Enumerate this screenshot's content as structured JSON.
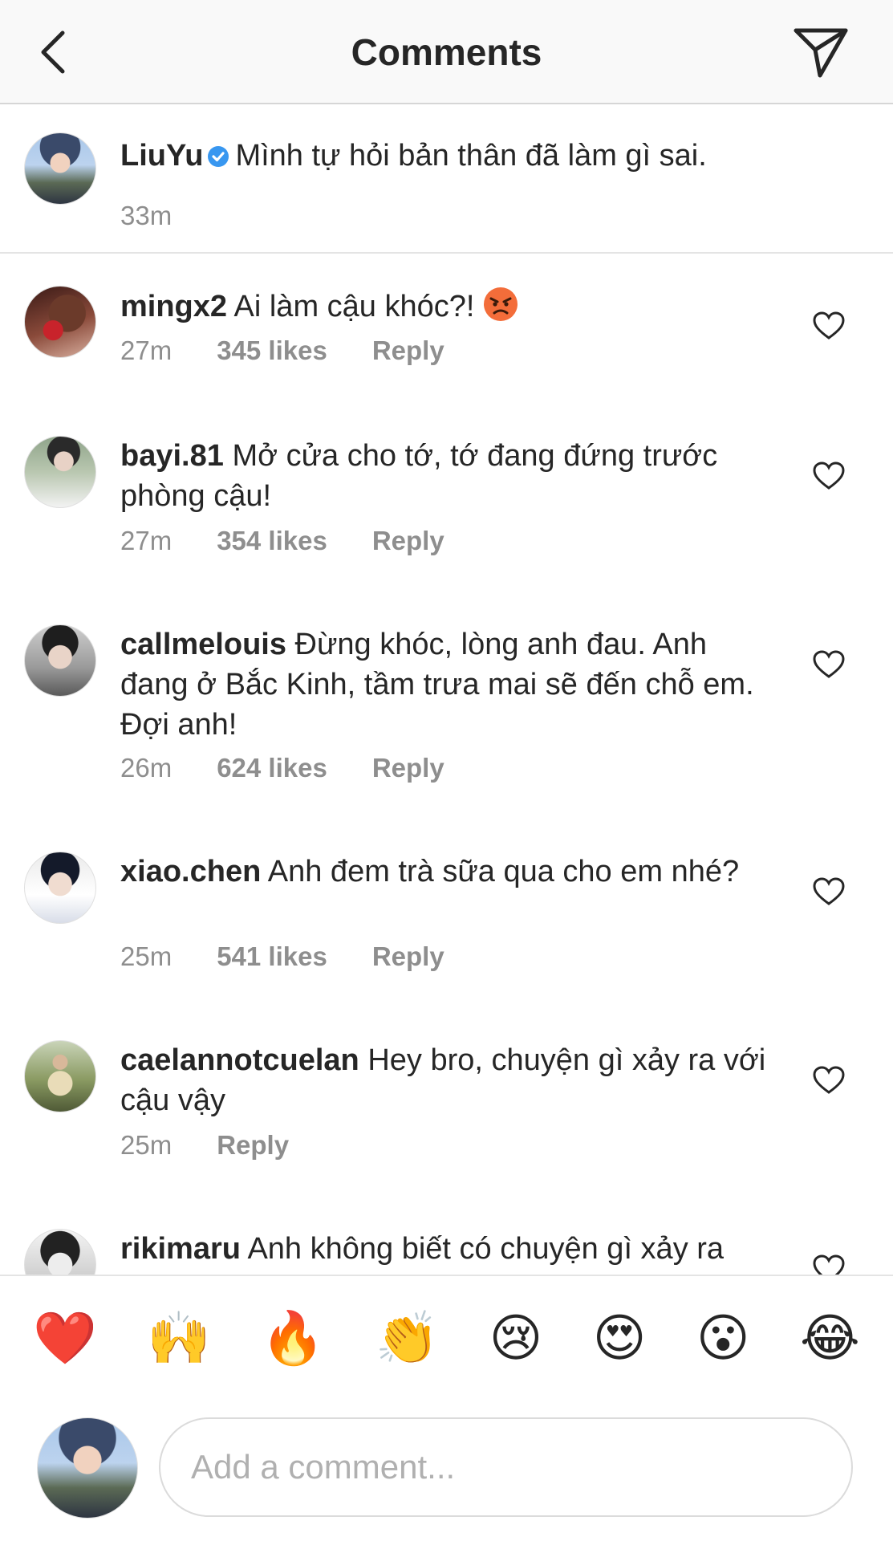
{
  "header": {
    "title": "Comments"
  },
  "caption": {
    "username": "LiuYu",
    "text": "Mình tự hỏi bản thân đã làm gì sai.",
    "time": "33m"
  },
  "comments": [
    {
      "username": "mingx2",
      "text": "Ai làm cậu khóc?!",
      "time": "27m",
      "likes": "345 likes",
      "reply": "Reply"
    },
    {
      "username": "bayi.81",
      "text": "Mở cửa cho tớ, tớ đang đứng trước phòng cậu!",
      "time": "27m",
      "likes": "354 likes",
      "reply": "Reply"
    },
    {
      "username": "callmelouis",
      "text": "Đừng khóc, lòng anh đau. Anh đang ở Bắc Kinh, tầm trưa mai sẽ đến chỗ em. Đợi anh!",
      "time": "26m",
      "likes": "624 likes",
      "reply": "Reply"
    },
    {
      "username": "xiao.chen",
      "text": "Anh đem trà sữa qua cho em nhé?",
      "time": "25m",
      "likes": "541 likes",
      "reply": "Reply"
    },
    {
      "username": "caelannotcuelan",
      "text": "Hey bro, chuyện gì xảy ra với cậu vậy",
      "time": "25m",
      "reply": "Reply"
    },
    {
      "username": "rikimaru",
      "text": "Anh không biết có chuyện gì xảy ra nhưng anh sẽ luôn ở bên em"
    }
  ],
  "reactions": [
    "❤️",
    "🙌",
    "🔥",
    "👏",
    "😢",
    "😍",
    "😮",
    "😂"
  ],
  "composer": {
    "placeholder": "Add a comment..."
  },
  "icons": {
    "back": "chevron-left-icon",
    "send": "paper-plane-icon",
    "verified": "verified-badge-icon",
    "like": "heart-outline-icon"
  },
  "colors": {
    "verified": "#3897f0",
    "secondary_text": "#8e8e8e",
    "primary_text": "#262626"
  }
}
